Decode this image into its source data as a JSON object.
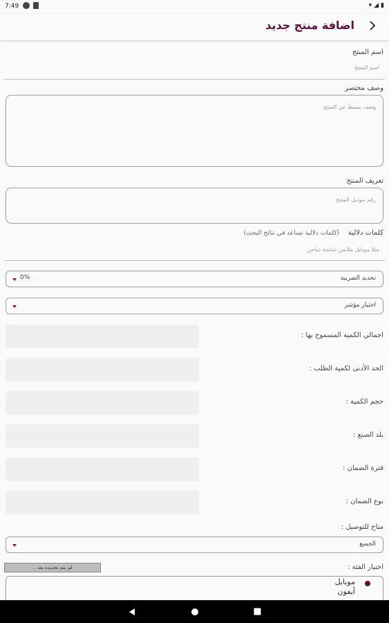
{
  "status": {
    "time": "7:49"
  },
  "header": {
    "title": "اضافة منتج جديد"
  },
  "form": {
    "product_name": {
      "label": "اسم المنتج",
      "placeholder": "اسم المنتج"
    },
    "short_desc": {
      "label": "وصف مختصر",
      "placeholder": "وصف بسيط عن المنتج"
    },
    "product_def": {
      "label": "تعريف المنتج",
      "placeholder": "رقم موديل المنتج"
    },
    "keywords": {
      "label": "كلمات دلالية",
      "hint": "(كلمات دلالية  تساعد في نتائج البحث)",
      "placeholder": "مثلا موبايل ملابس شاشة شاحن"
    },
    "tax": {
      "label": "تحديد الضريبة",
      "value": "0%"
    },
    "indicator": {
      "label": "اختيار مؤشر"
    },
    "readonly_fields": [
      {
        "label": "اجمالي الكمية المسموح بها :"
      },
      {
        "label": "الحد الأدنى لكمية الطلب :"
      },
      {
        "label": "حجم الكمية :"
      },
      {
        "label": "بلد الصنع :"
      },
      {
        "label": "فترة الضمان :"
      },
      {
        "label": "نوع الضمان :"
      }
    ],
    "delivery": {
      "label": "متاح للتوصيل :",
      "value": "الجميع"
    },
    "category": {
      "label": "اختيار الفئة :",
      "button": "لم يتم تحديده بعد ..",
      "items": [
        "موبايل",
        "أيفون"
      ]
    }
  },
  "colors": {
    "accent": "#5a1040",
    "caret": "#8b1a1a"
  }
}
